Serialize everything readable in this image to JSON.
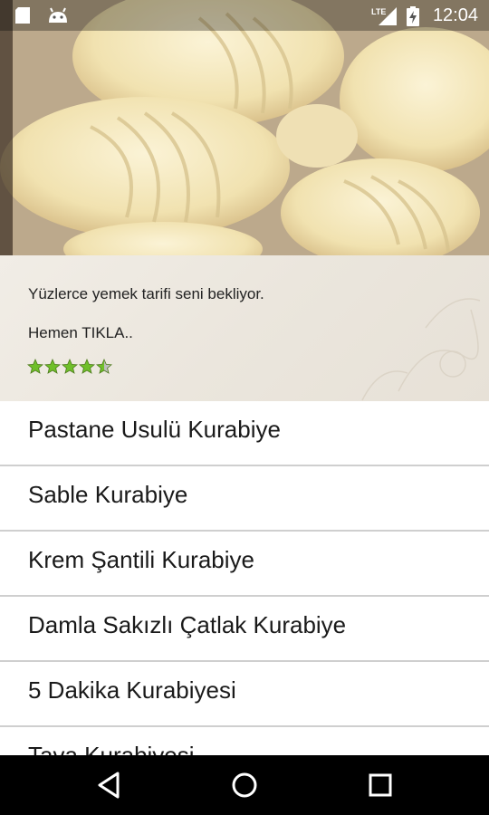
{
  "status_bar": {
    "time": "12:04",
    "network": "LTE",
    "icons": [
      "sd-card-icon",
      "android-icon",
      "lte-signal-icon",
      "battery-charging-icon"
    ]
  },
  "promo": {
    "line1": "Yüzlerce yemek tarifi seni bekliyor.",
    "line2": "Hemen TIKLA..",
    "rating": 4.5,
    "rating_max": 5
  },
  "recipes": [
    "Pastane Usulü Kurabiye",
    "Sable Kurabiye",
    "Krem Şantili Kurabiye",
    "Damla Sakızlı Çatlak Kurabiye",
    "5 Dakika Kurabiyesi",
    "Tava Kurabiyesi"
  ],
  "nav_bar": {
    "buttons": [
      "back-icon",
      "home-icon",
      "recents-icon"
    ]
  },
  "colors": {
    "star_green": "#6fbf2a",
    "divider": "#cfcfcf",
    "navbar": "#000000"
  }
}
